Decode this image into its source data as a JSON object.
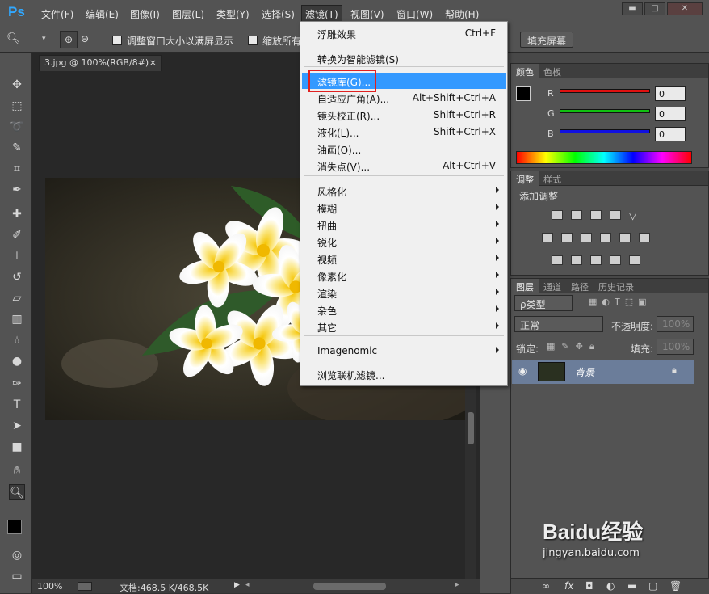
{
  "app": {
    "logo": "Ps"
  },
  "menubar": [
    "文件(F)",
    "编辑(E)",
    "图像(I)",
    "图层(L)",
    "类型(Y)",
    "选择(S)",
    "滤镜(T)",
    "视图(V)",
    "窗口(W)",
    "帮助(H)"
  ],
  "window_buttons": [
    "▬",
    "□",
    "✕"
  ],
  "options": {
    "resize_label": "调整窗口大小以满屏显示",
    "zoom_all_label": "缩放所有",
    "fill_screen_button": "填充屏幕"
  },
  "document": {
    "tab_title": "3.jpg @ 100%(RGB/8#)",
    "tab_close": "×",
    "zoom": "100%",
    "doc_info": "文档:468.5 K/468.5K"
  },
  "filter_menu": {
    "items": [
      {
        "label": "浮雕效果",
        "shortcut": "Ctrl+F"
      },
      {
        "label": "转换为智能滤镜(S)",
        "shortcut": ""
      },
      {
        "label": "滤镜库(G)...",
        "shortcut": "",
        "highlighted": true
      },
      {
        "label": "自适应广角(A)...",
        "shortcut": "Alt+Shift+Ctrl+A"
      },
      {
        "label": "镜头校正(R)...",
        "shortcut": "Shift+Ctrl+R"
      },
      {
        "label": "液化(L)...",
        "shortcut": "Shift+Ctrl+X"
      },
      {
        "label": "油画(O)...",
        "shortcut": ""
      },
      {
        "label": "消失点(V)...",
        "shortcut": "Alt+Ctrl+V"
      },
      {
        "label": "风格化",
        "submenu": true
      },
      {
        "label": "模糊",
        "submenu": true
      },
      {
        "label": "扭曲",
        "submenu": true
      },
      {
        "label": "锐化",
        "submenu": true
      },
      {
        "label": "视频",
        "submenu": true
      },
      {
        "label": "像素化",
        "submenu": true
      },
      {
        "label": "渲染",
        "submenu": true
      },
      {
        "label": "杂色",
        "submenu": true
      },
      {
        "label": "其它",
        "submenu": true
      },
      {
        "label": "Imagenomic",
        "submenu": true
      },
      {
        "label": "浏览联机滤镜...",
        "shortcut": ""
      }
    ]
  },
  "color_panel": {
    "tabs": [
      "颜色",
      "色板"
    ],
    "channels": [
      {
        "name": "R",
        "value": "0",
        "color": "#e01010"
      },
      {
        "name": "G",
        "value": "0",
        "color": "#10c010"
      },
      {
        "name": "B",
        "value": "0",
        "color": "#1010e0"
      }
    ]
  },
  "adjust_panel": {
    "tabs": [
      "调整",
      "样式"
    ],
    "title": "添加调整"
  },
  "layers_panel": {
    "tabs": [
      "图层",
      "通道",
      "路径",
      "历史记录"
    ],
    "kind_select": "ρ类型",
    "blend_mode": "正常",
    "opacity_label": "不透明度:",
    "opacity_value": "100%",
    "lock_label": "锁定:",
    "fill_label": "填充:",
    "fill_value": "100%",
    "layer_name": "背景",
    "footer_fx": "fx"
  },
  "watermark": {
    "brand": "Baidu经验",
    "url": "jingyan.baidu.com"
  }
}
